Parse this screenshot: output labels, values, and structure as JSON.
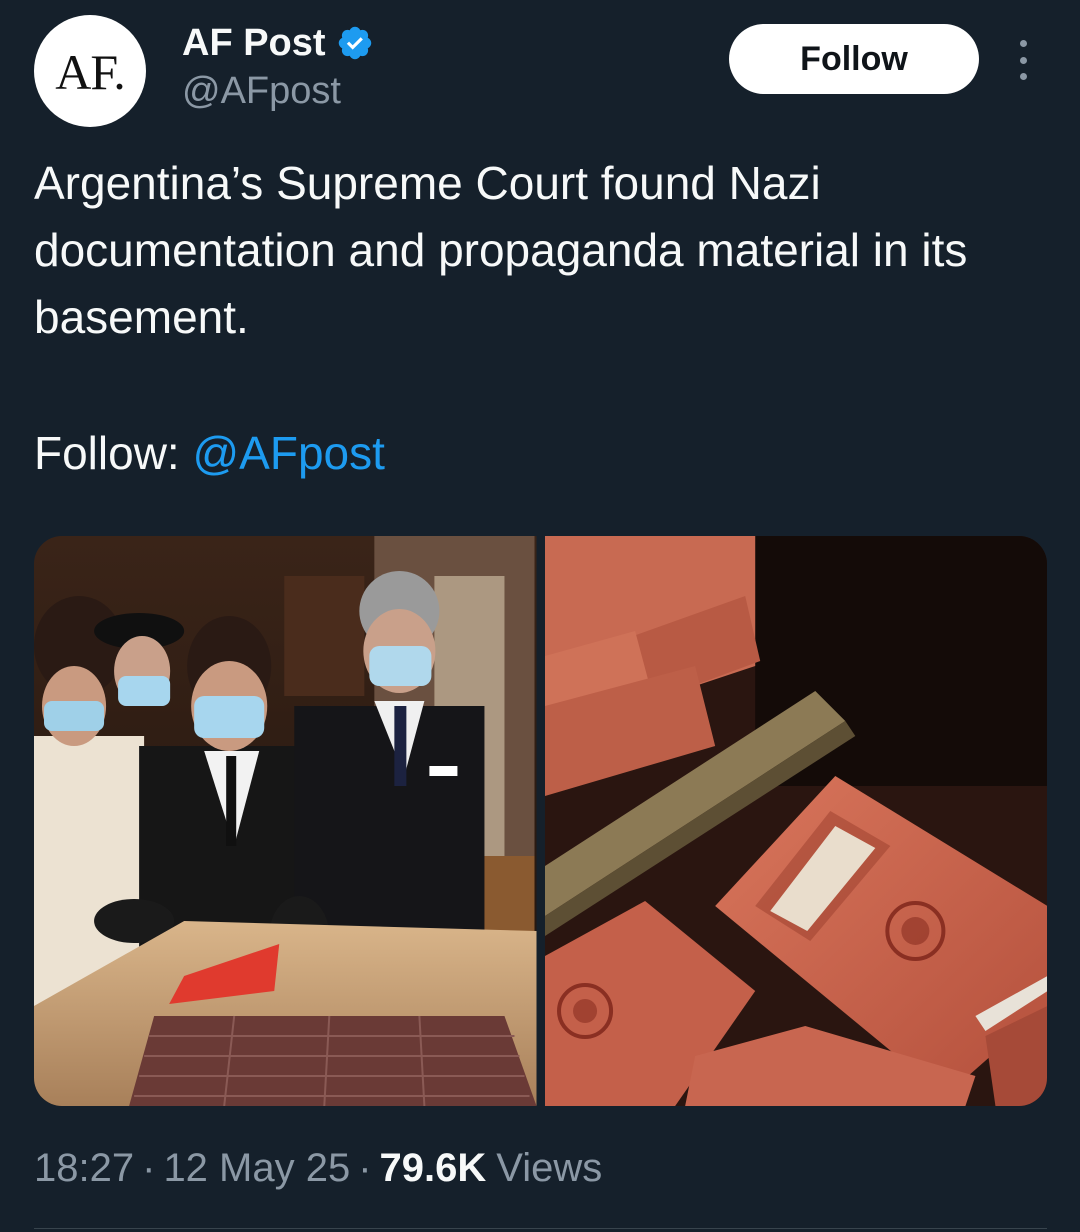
{
  "author": {
    "avatar_text": "AF.",
    "display_name": "AF Post",
    "handle": "@AFpost",
    "verified": true
  },
  "follow_button_label": "Follow",
  "more_icon": "more-vertical-icon",
  "tweet": {
    "text": "Argentina’s Supreme Court found Nazi documentation and propaganda material in its basement.",
    "follow_prefix": "Follow: ",
    "follow_mention": "@AFpost"
  },
  "media": [
    {
      "name": "photo-officials-inspecting-box"
    },
    {
      "name": "photo-red-booklets-closeup"
    }
  ],
  "meta": {
    "time": "18:27",
    "sep1": "·",
    "date": "12 May 25",
    "sep2": "·",
    "views_count": "79.6K",
    "views_label": "Views"
  },
  "colors": {
    "background": "#15202b",
    "text": "#f7f9f9",
    "secondary": "#8b98a5",
    "accent": "#1d9bf0"
  }
}
